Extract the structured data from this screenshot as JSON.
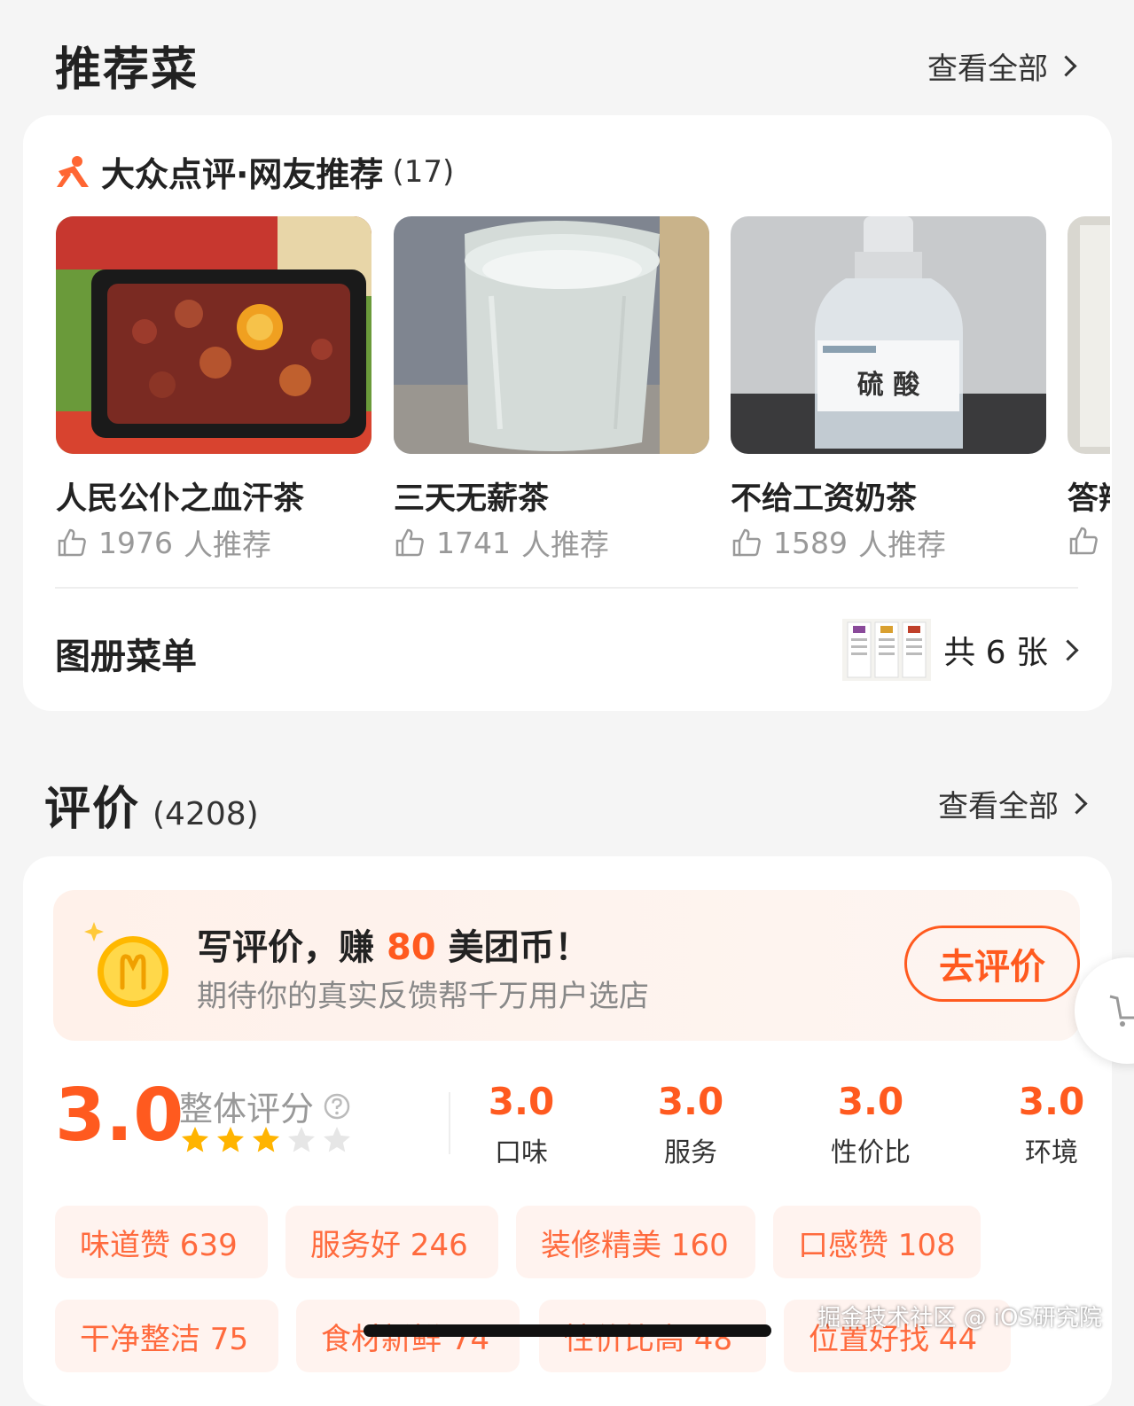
{
  "recommend": {
    "title": "推荐菜",
    "view_all": "查看全部",
    "source_title": "大众点评·网友推荐",
    "source_count": "(17)",
    "dishes": [
      {
        "name": "人民公仆之血汗茶",
        "count": "1976",
        "suffix": "人推荐"
      },
      {
        "name": "三天无薪茶",
        "count": "1741",
        "suffix": "人推荐"
      },
      {
        "name": "不给工资奶茶",
        "count": "1589",
        "suffix": "人推荐"
      },
      {
        "name": "答辩"
      }
    ],
    "bottle_label": "硫 酸",
    "album_label": "图册菜单",
    "album_count": "共 6 张"
  },
  "reviews": {
    "title": "评价",
    "count": "(4208)",
    "view_all": "查看全部",
    "promo": {
      "line1_prefix": "写评价，赚 ",
      "line1_amount": "80",
      "line1_suffix": " 美团币！",
      "line2": "期待你的真实反馈帮千万用户选店",
      "button": "去评价"
    },
    "overall": {
      "score": "3.0",
      "label": "整体评分",
      "stars_filled": 3,
      "stars_total": 5
    },
    "sub_ratings": [
      {
        "value": "3.0",
        "label": "口味"
      },
      {
        "value": "3.0",
        "label": "服务"
      },
      {
        "value": "3.0",
        "label": "性价比"
      },
      {
        "value": "3.0",
        "label": "环境"
      }
    ],
    "tags": [
      "味道赞 639",
      "服务好 246",
      "装修精美 160",
      "口感赞 108",
      "干净整洁 75",
      "食材新鲜 74",
      "性价比高 48",
      "位置好找 44"
    ]
  },
  "watermark": "掘金技术社区 @ iOS研究院",
  "colors": {
    "accent": "#ff5a1f",
    "tag_bg": "#fff3ef",
    "bg": "#f5f5f5"
  }
}
